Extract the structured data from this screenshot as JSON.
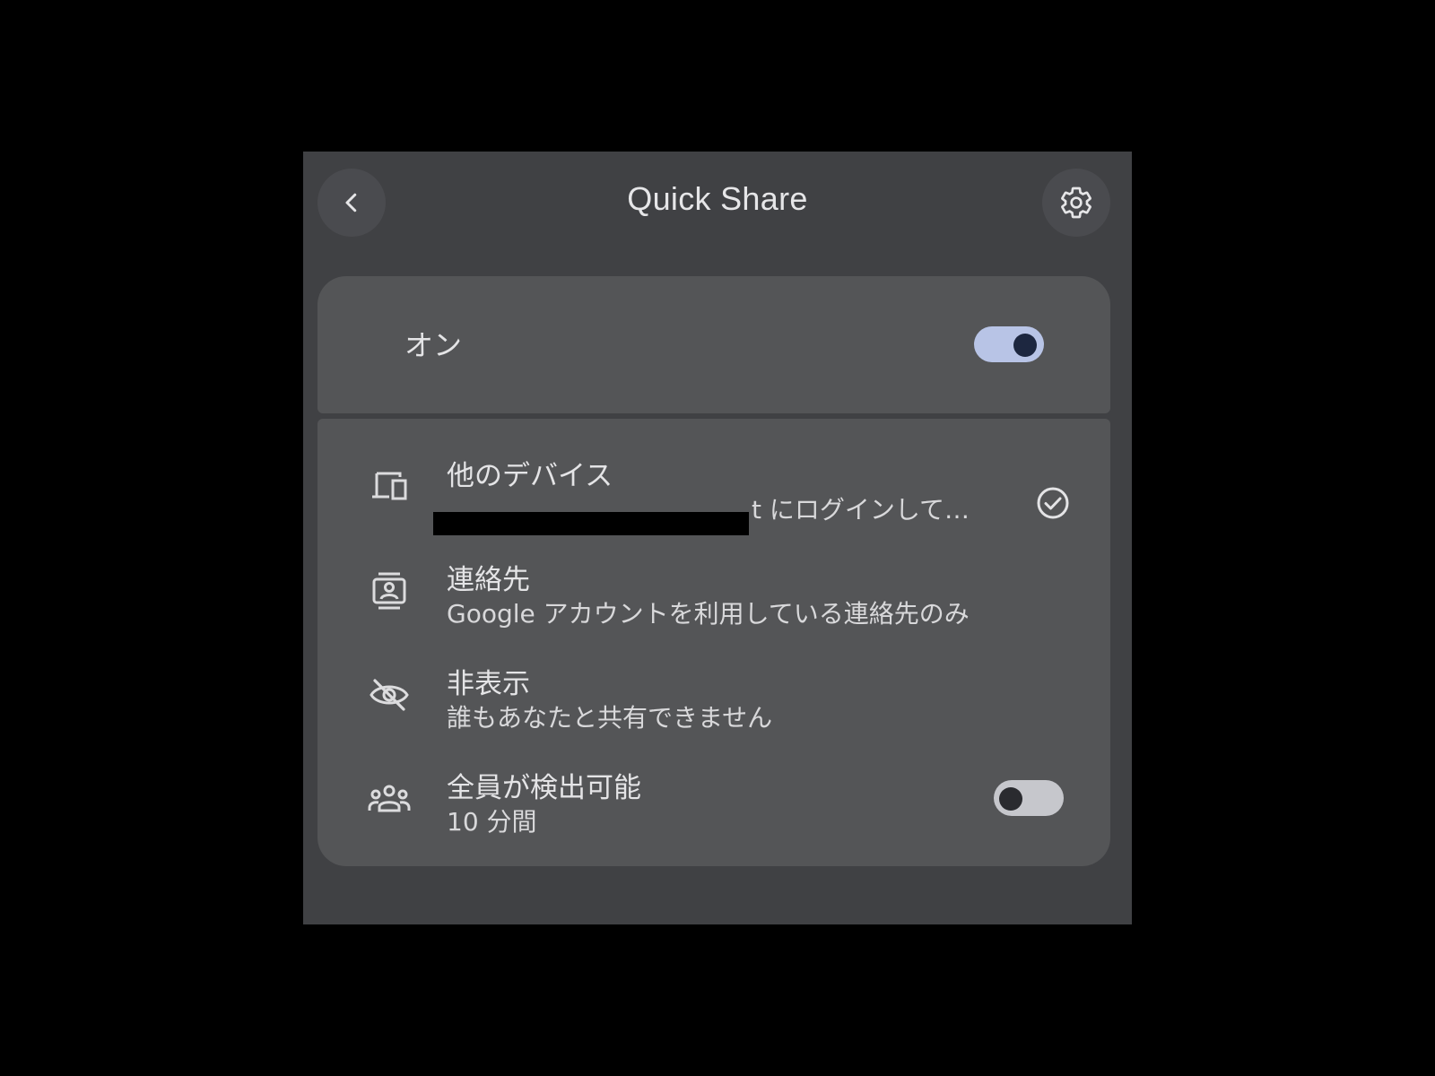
{
  "header": {
    "title": "Quick Share",
    "back_icon": "chevron-left-icon",
    "settings_icon": "gear-icon"
  },
  "main_toggle": {
    "label": "オン",
    "state": "on"
  },
  "visibility_options": [
    {
      "icon": "devices-icon",
      "title": "他のデバイス",
      "subtitle": "t にログインして…",
      "selected": true
    },
    {
      "icon": "contacts-icon",
      "title": "連絡先",
      "subtitle": "Google アカウントを利用している連絡先のみ",
      "selected": false
    },
    {
      "icon": "eye-off-icon",
      "title": "非表示",
      "subtitle": "誰もあなたと共有できません",
      "selected": false
    },
    {
      "icon": "group-icon",
      "title": "全員が検出可能",
      "subtitle": "10 分間",
      "toggle_state": "off"
    }
  ],
  "colors": {
    "background": "#000000",
    "panel": "#404144",
    "card": "#545557",
    "toggle_on_track": "#b8c4e6",
    "toggle_on_knob": "#1d2740",
    "toggle_off_track": "#c6c7cc",
    "text": "#e4e4e6"
  }
}
